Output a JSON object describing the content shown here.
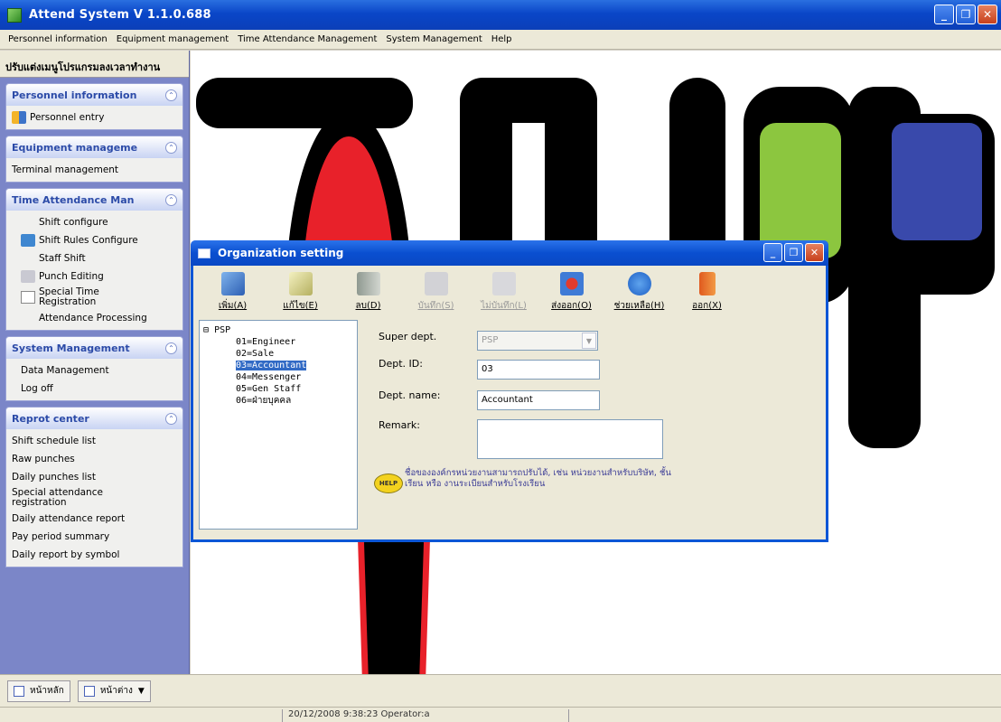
{
  "window": {
    "title": "Attend System V 1.1.0.688",
    "min": "_",
    "max": "❐",
    "close": "✕"
  },
  "menu": [
    "Personnel information",
    "Equipment management",
    "Time Attendance Management",
    "System Management",
    "Help"
  ],
  "left_nav": {
    "header": "ปรับแต่งเมนูโปรแกรมลงเวลาทำงาน",
    "collapse_glyph": "⌃",
    "groups": [
      {
        "title": "Personnel information",
        "items": [
          "Personnel entry"
        ]
      },
      {
        "title": "Equipment manageme",
        "items": [
          "Terminal management"
        ]
      },
      {
        "title": "Time Attendance Man",
        "items": [
          "Shift configure",
          "Shift Rules Configure",
          "Staff Shift",
          "Punch Editing",
          "Special Time Registration",
          "Attendance Processing"
        ]
      },
      {
        "title": "System Management",
        "items": [
          "Data Management",
          "Log off"
        ]
      },
      {
        "title": "Reprot center",
        "items": [
          "Shift schedule list",
          "Raw punches",
          "Daily punches list",
          "Special attendance registration",
          "Daily attendance report",
          "Pay period summary",
          "Daily report by symbol"
        ]
      }
    ]
  },
  "dialog": {
    "title": "Organization setting",
    "toolbar": [
      "เพิ่ม(A)",
      "แก้ไข(E)",
      "ลบ(D)",
      "บันทึก(S)",
      "ไม่บันทึก(L)",
      "ส่งออก(O)",
      "ช่วยเหลือ(H)",
      "ออก(X)"
    ],
    "tree": {
      "root": "PSP",
      "root_toggle": "⊟",
      "children": [
        "01=Engineer",
        "02=Sale",
        "03=Accountant",
        "04=Messenger",
        "05=Gen Staff",
        "06=ฝ่ายบุคคล"
      ],
      "selected": "03=Accountant"
    },
    "form": {
      "super_dept_label": "Super dept.",
      "super_dept_value": "PSP",
      "dropdown_glyph": "▼",
      "dept_id_label": "Dept. ID:",
      "dept_id_value": "03",
      "dept_name_label": "Dept. name:",
      "dept_name_value": "Accountant",
      "remark_label": "Remark:",
      "remark_value": ""
    },
    "help_badge": "HELP",
    "help_text": "ชื่อขององค์กรหน่วยงานสามารถปรับได้, เช่น หน่วยงานสำหรับบริษัท, ชั้นเรียน หรือ งานระเบียนสำหรับโรงเรียน"
  },
  "bottom": {
    "buttons": [
      "หน้าหลัก",
      "หน้าต่าง"
    ],
    "dropdown_arrow": "▼",
    "status": "20/12/2008 9:38:23 Operator:a"
  }
}
